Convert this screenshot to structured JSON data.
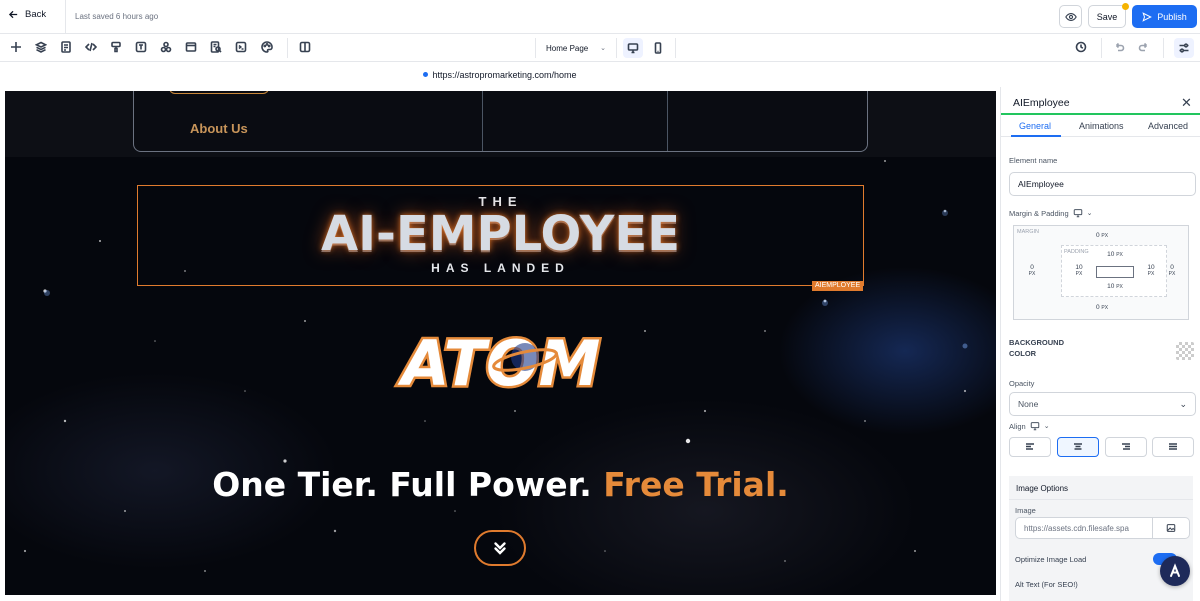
{
  "topbar": {
    "back_label": "Back",
    "last_saved": "Last saved 6 hours ago",
    "save_label": "Save",
    "publish_label": "Publish"
  },
  "toolbar": {
    "tools": [
      "add-icon",
      "layers-icon",
      "pages-icon",
      "code-icon",
      "paint-icon",
      "text-icon",
      "components-icon",
      "layout-icon",
      "seo-icon",
      "terminal-icon",
      "palette-icon",
      "split-view-icon"
    ],
    "page_select": "Home Page",
    "right_tools": [
      "history-icon",
      "undo-icon",
      "redo-icon",
      "settings-sliders-icon"
    ]
  },
  "url": "https://astropromarketing.com/home",
  "canvas": {
    "nav_link": "About Us",
    "hero_line1": "THE",
    "hero_line2": "AI-EMPLOYEE",
    "hero_line3": "HAS LANDED",
    "selected_tag": "AIEMPLOYEE",
    "logo_text": "ATOM",
    "tagline_main": "One Tier. Full Power.",
    "tagline_accent": "Free Trial.",
    "colors": {
      "accent": "#e58a3a",
      "border": "#e07b2e"
    }
  },
  "panel": {
    "title": "AIEmployee",
    "tabs": [
      "General",
      "Animations",
      "Advanced"
    ],
    "active_tab": "General",
    "element_name_label": "Element name",
    "element_name_value": "AIEmployee",
    "margin_padding_label": "Margin & Padding",
    "margin_tag": "MARGIN",
    "padding_tag": "PADDING",
    "margin": {
      "top": "0",
      "right": "0",
      "bottom": "0",
      "left": "0",
      "unit": "PX"
    },
    "padding": {
      "top": "10",
      "right": "10",
      "bottom": "10",
      "left": "10",
      "unit": "PX"
    },
    "bg_color_label_1": "BACKGROUND",
    "bg_color_label_2": "COLOR",
    "opacity_label": "Opacity",
    "opacity_value": "None",
    "align_label": "Align",
    "image_options_label": "Image Options",
    "image_label": "Image",
    "image_url": "https://assets.cdn.filesafe.spa",
    "optimize_label": "Optimize Image Load",
    "alt_text_label": "Alt Text (For SEO!)"
  }
}
